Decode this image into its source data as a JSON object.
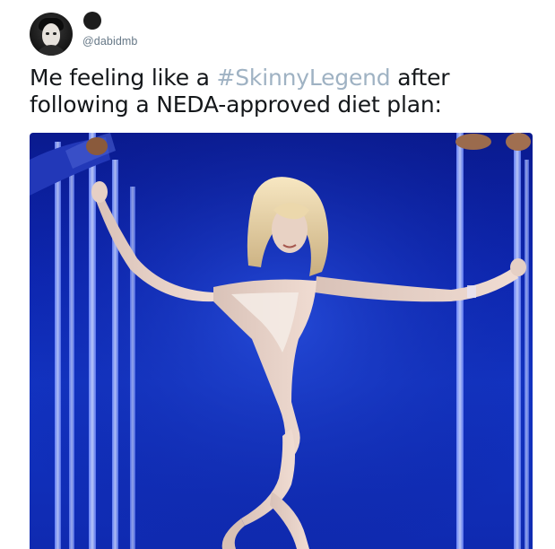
{
  "user": {
    "handle": "@dabidmb"
  },
  "tweet": {
    "text_before": "Me feeling like a ",
    "hashtag": "#SkinnyLegend",
    "text_after": " after following a NEDA-approved diet plan:"
  },
  "colors": {
    "text": "#14171a",
    "handle": "#657786",
    "hashtag": "#9fb2c3",
    "media_background": "#1234c4"
  },
  "icons": {
    "avatar": "user-avatar",
    "name": "display-name-placeholder"
  }
}
